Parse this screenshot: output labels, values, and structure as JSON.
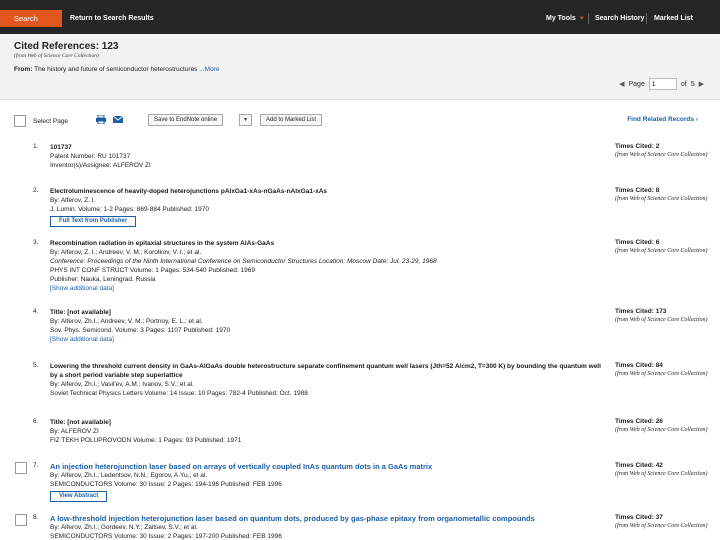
{
  "topbar": {
    "search_tab": "Search",
    "return_link": "Return to Search Results",
    "my_tools": "My Tools",
    "search_history": "Search History",
    "marked_list": "Marked List"
  },
  "header": {
    "title": "Cited References: 123",
    "subtitle": "(from Web of Science Core Collection)",
    "from_label": "From:",
    "from_text": "The history and future of semiconductor heterostructures",
    "more": "...More",
    "page_label": "Page",
    "page_value": "1",
    "of_label": "of",
    "total_pages": "5"
  },
  "toolbar": {
    "select_page": "Select Page",
    "save_to": "Save to EndNote online",
    "add_marked": "Add to Marked List",
    "find_related": "Find Related Records"
  },
  "records": [
    {
      "num": "1.",
      "title": "101737",
      "lines": [
        "Patent Number: RU 101737",
        "Inventor(s)/Assignee: ALFEROV ZI"
      ],
      "times_cited": "Times Cited: 2",
      "tc_note": "(from Web of Science Core Collection)"
    },
    {
      "num": "2.",
      "title": "Electroluminescence of heavily-doped heterojunctions pAlxGa1-xAs-nGaAs-nAlxGa1-xAs",
      "lines": [
        "By: Alferov, Z. I.",
        "J. Lumin.  Volume: 1-2   Pages: 869-884   Published: 1970"
      ],
      "button": "Full Text from Publisher",
      "times_cited": "Times Cited: 8",
      "tc_note": "(from Web of Science Core Collection)"
    },
    {
      "num": "3.",
      "title": "Recombination radiation in epitaxial structures in the system AlAs-GaAs",
      "lines": [
        "By: Alferov, Z. I.; Andreev, V. M.; Korolkov, V. I.; et al.",
        "Conference: Proceedings of the Ninth International Conference on Semiconductor Structures Location: Moscow Date: Jul. 23-29, 1968",
        "PHYS INT CONF STRUCT  Volume: 1   Pages: 534-540   Published: 1969",
        "Publisher: Nauka, Leningrad, Russia"
      ],
      "addl": "[Show additional data]",
      "times_cited": "Times Cited: 6",
      "tc_note": "(from Web of Science Core Collection)"
    },
    {
      "num": "4.",
      "title": "Title: [not available]",
      "lines": [
        "By: Alferov, Zh.I.; Andreev, V. M.; Portnoy, E. L.; et al.",
        "Sov. Phys. Semicond.  Volume: 3   Pages: 1107   Published: 1970"
      ],
      "addl": "[Show additional data]",
      "times_cited": "Times Cited: 173",
      "tc_note": "(from Web of Science Core Collection)"
    },
    {
      "num": "5.",
      "title": "Lowering the threshold current density in GaAs-AlGaAs double heterostructure separate confinement quantum well lasers (Jth=52 A/cm2, T=300 K) by bounding the quantum well by a short period variable step superlattice",
      "lines": [
        "By: Alferov, Zh.I.; Vasil'ev, A.M.; Ivanov, S.V.; et al.",
        "Soviet Technical Physics Letters  Volume: 14   Issue: 10   Pages: 782-4   Published: Oct. 1988"
      ],
      "times_cited": "Times Cited: 84",
      "tc_note": "(from Web of Science Core Collection)"
    },
    {
      "num": "6.",
      "title": "Title: [not available]",
      "lines": [
        "By: ALFEROV ZI",
        "FIZ TEKH POLUPROVODN  Volume: 1   Pages: 93   Published: 1971"
      ],
      "times_cited": "Times Cited: 26",
      "tc_note": "(from Web of Science Core Collection)"
    },
    {
      "num": "7.",
      "title": "An injection heterojunction laser based on arrays of vertically coupled InAs quantum dots in a GaAs matrix",
      "lines": [
        "By: Alferov, Zh.I.; Ledentsov, N.N.; Egorov, A.Yu.; et al.",
        "SEMICONDUCTORS  Volume: 30   Issue: 2   Pages: 194-196   Published: FEB 1996"
      ],
      "button": "View Abstract",
      "times_cited": "Times Cited: 42",
      "tc_note": "(from Web of Science Core Collection)"
    },
    {
      "num": "8.",
      "title": "A low-threshold injection heterojunction laser based on quantum dots, produced by gas-phase epitaxy from organometallic compounds",
      "lines": [
        "By: Alferov, Zh.I.; Gordeev, N.Y.; Zaitsev, S.V.; et al.",
        "SEMICONDUCTORS  Volume: 30   Issue: 2   Pages: 197-200   Published: FEB 1996"
      ],
      "times_cited": "Times Cited: 37",
      "tc_note": "(from Web of Science Core Collection)"
    }
  ]
}
